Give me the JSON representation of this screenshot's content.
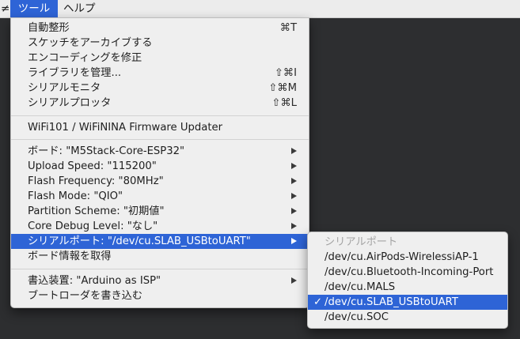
{
  "menubar": {
    "partial": "≠",
    "tools": "ツール",
    "help": "ヘルプ"
  },
  "tools_menu": {
    "auto_format": {
      "label": "自動整形",
      "shortcut": "⌘T"
    },
    "archive_sketch": {
      "label": "スケッチをアーカイブする"
    },
    "fix_encoding": {
      "label": "エンコーディングを修正"
    },
    "manage_libraries": {
      "label": "ライブラリを管理...",
      "shortcut": "⇧⌘I"
    },
    "serial_monitor": {
      "label": "シリアルモニタ",
      "shortcut": "⇧⌘M"
    },
    "serial_plotter": {
      "label": "シリアルプロッタ",
      "shortcut": "⇧⌘L"
    },
    "firmware_updater": {
      "label": "WiFi101 / WiFiNINA Firmware Updater"
    },
    "board": {
      "label": "ボード: \"M5Stack-Core-ESP32\""
    },
    "upload_speed": {
      "label": "Upload Speed: \"115200\""
    },
    "flash_frequency": {
      "label": "Flash Frequency: \"80MHz\""
    },
    "flash_mode": {
      "label": "Flash Mode: \"QIO\""
    },
    "partition_scheme": {
      "label": "Partition Scheme: \"初期値\""
    },
    "core_debug_level": {
      "label": "Core Debug Level: \"なし\""
    },
    "serial_port": {
      "label": "シリアルポート: \"/dev/cu.SLAB_USBtoUART\""
    },
    "board_info": {
      "label": "ボード情報を取得"
    },
    "programmer": {
      "label": "書込装置: \"Arduino as ISP\""
    },
    "burn_bootloader": {
      "label": "ブートローダを書き込む"
    }
  },
  "port_submenu": {
    "header": "シリアルポート",
    "check_mark": "✓",
    "ports": [
      "/dev/cu.AirPods-WirelessiAP-1",
      "/dev/cu.Bluetooth-Incoming-Port",
      "/dev/cu.MALS",
      "/dev/cu.SLAB_USBtoUART",
      "/dev/cu.SOC"
    ],
    "selected": "/dev/cu.SLAB_USBtoUART"
  }
}
